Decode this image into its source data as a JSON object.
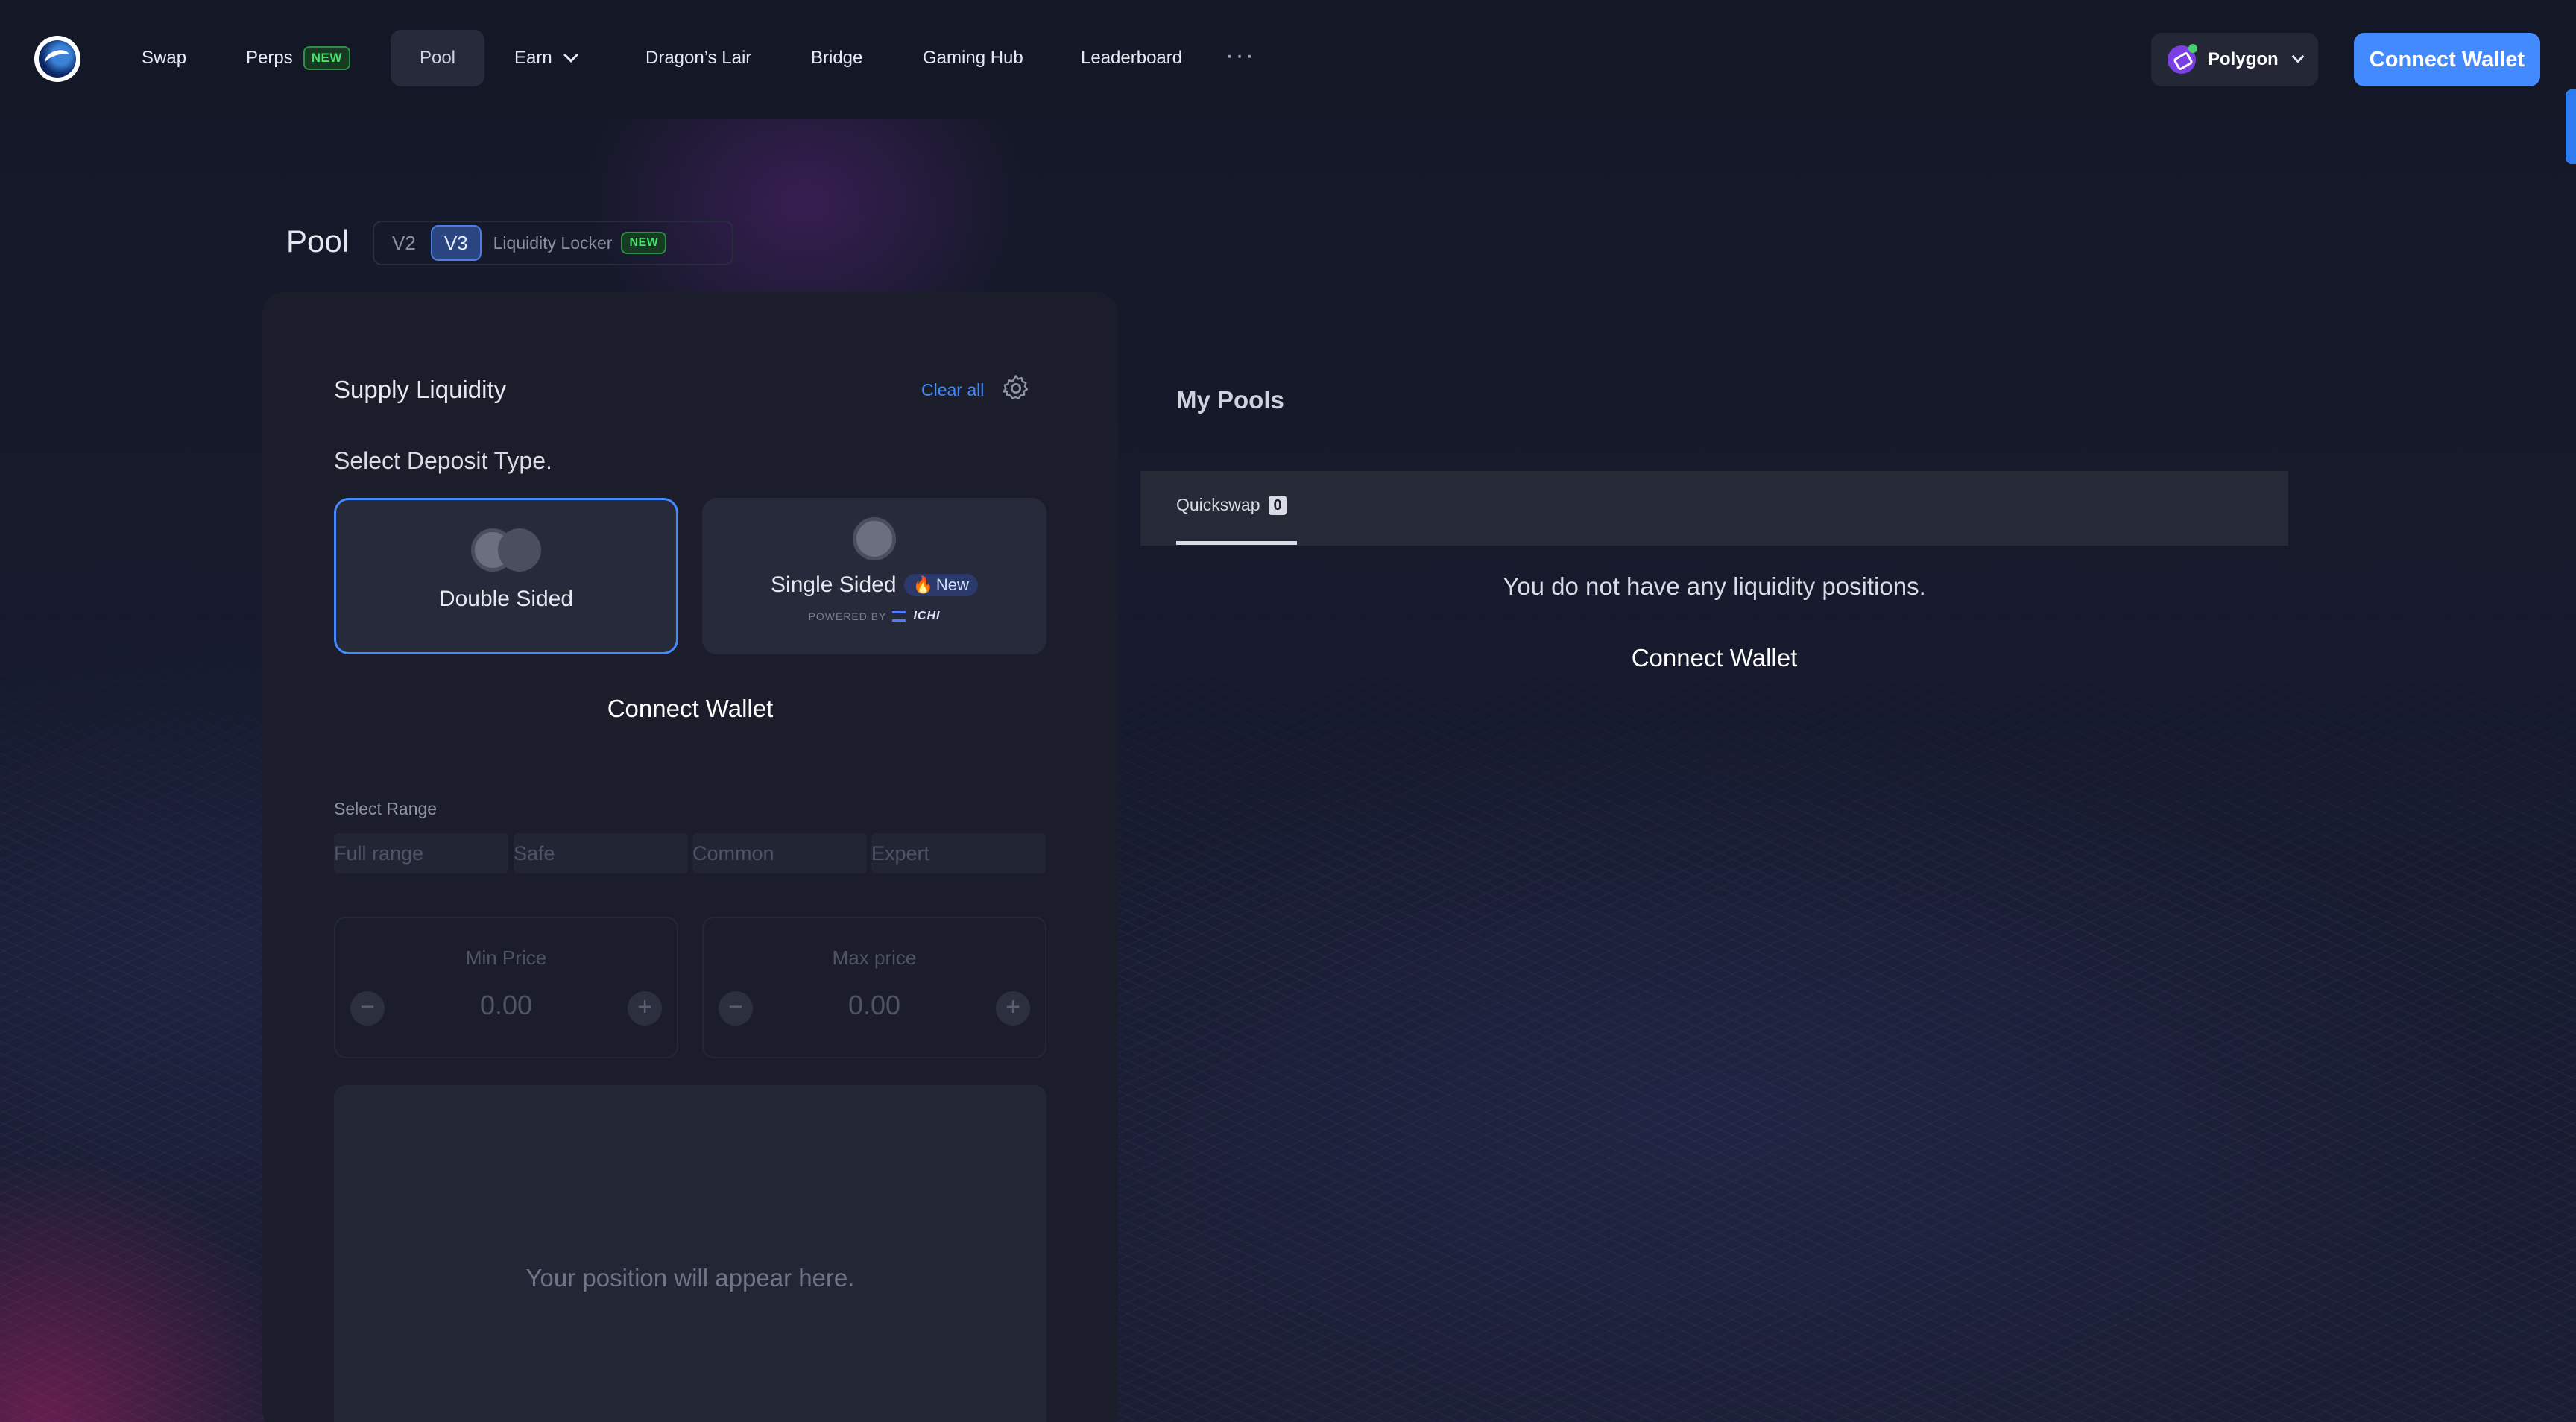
{
  "nav": {
    "items": [
      {
        "label": "Swap"
      },
      {
        "label": "Perps",
        "badge": "NEW"
      },
      {
        "label": "Pool"
      },
      {
        "label": "Earn"
      },
      {
        "label": "Dragon’s Lair"
      },
      {
        "label": "Bridge"
      },
      {
        "label": "Gaming Hub"
      },
      {
        "label": "Leaderboard"
      }
    ],
    "more": "···",
    "network": "Polygon",
    "connect_wallet": "Connect Wallet"
  },
  "pool": {
    "title": "Pool",
    "versions": [
      "V2",
      "V3",
      "Liquidity Locker"
    ],
    "locker_badge": "NEW",
    "selected_version": "V3"
  },
  "supply": {
    "title": "Supply Liquidity",
    "clear_all": "Clear all",
    "deposit_label": "Select Deposit Type.",
    "double_sided": "Double Sided",
    "single_sided": "Single Sided",
    "new_badge": "New",
    "powered_by": "POWERED BY",
    "ichi": "ICHI",
    "connect_wallet": "Connect Wallet",
    "range_label": "Select Range",
    "ranges": [
      "Full range",
      "Safe",
      "Common",
      "Expert"
    ],
    "min_price_label": "Min Price",
    "max_price_label": "Max price",
    "min_price_value": "0.00",
    "max_price_value": "0.00",
    "position_placeholder": "Your position will appear here."
  },
  "my_pools": {
    "title": "My Pools",
    "tab_label": "Quickswap",
    "tab_count": "0",
    "empty_text": "You do not have any liquidity positions.",
    "connect_wallet": "Connect Wallet"
  },
  "colors": {
    "accent": "#448aff",
    "new_badge": "#49e26c",
    "background": "#121623",
    "card": "#1b1e2a"
  }
}
